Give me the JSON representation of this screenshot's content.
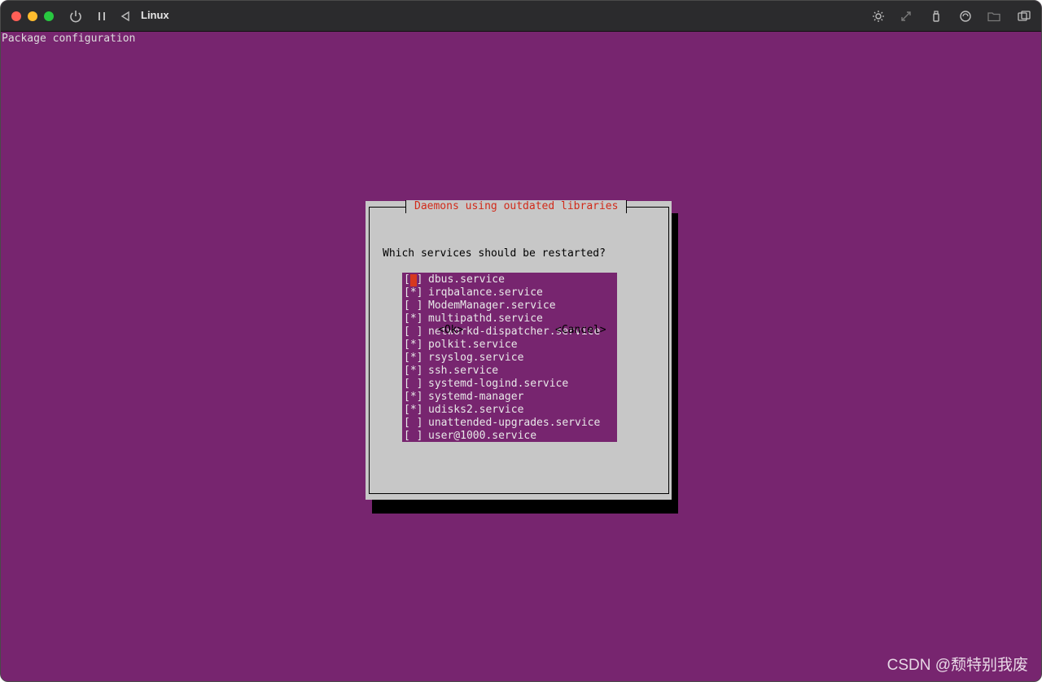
{
  "window": {
    "title": "Linux"
  },
  "terminal": {
    "header": "Package configuration"
  },
  "dialog": {
    "title": "Daemons using outdated libraries",
    "prompt": "Which services should be restarted?",
    "items": [
      {
        "checkbox": "[ ]",
        "label": "dbus.service",
        "checked": false,
        "focused": true
      },
      {
        "checkbox": "[*]",
        "label": "irqbalance.service",
        "checked": true
      },
      {
        "checkbox": "[ ]",
        "label": "ModemManager.service",
        "checked": false
      },
      {
        "checkbox": "[*]",
        "label": "multipathd.service",
        "checked": true
      },
      {
        "checkbox": "[ ]",
        "label": "networkd-dispatcher.service",
        "checked": false
      },
      {
        "checkbox": "[*]",
        "label": "polkit.service",
        "checked": true
      },
      {
        "checkbox": "[*]",
        "label": "rsyslog.service",
        "checked": true
      },
      {
        "checkbox": "[*]",
        "label": "ssh.service",
        "checked": true
      },
      {
        "checkbox": "[ ]",
        "label": "systemd-logind.service",
        "checked": false
      },
      {
        "checkbox": "[*]",
        "label": "systemd-manager",
        "checked": true
      },
      {
        "checkbox": "[*]",
        "label": "udisks2.service",
        "checked": true
      },
      {
        "checkbox": "[ ]",
        "label": "unattended-upgrades.service",
        "checked": false
      },
      {
        "checkbox": "[ ]",
        "label": "user@1000.service",
        "checked": false
      }
    ],
    "ok_label": "<Ok>",
    "cancel_label": "<Cancel>"
  },
  "watermark": "CSDN @颓特别我废",
  "colors": {
    "background": "#77256f",
    "dialog": "#c7c7c7",
    "title_accent": "#d12a1a"
  }
}
